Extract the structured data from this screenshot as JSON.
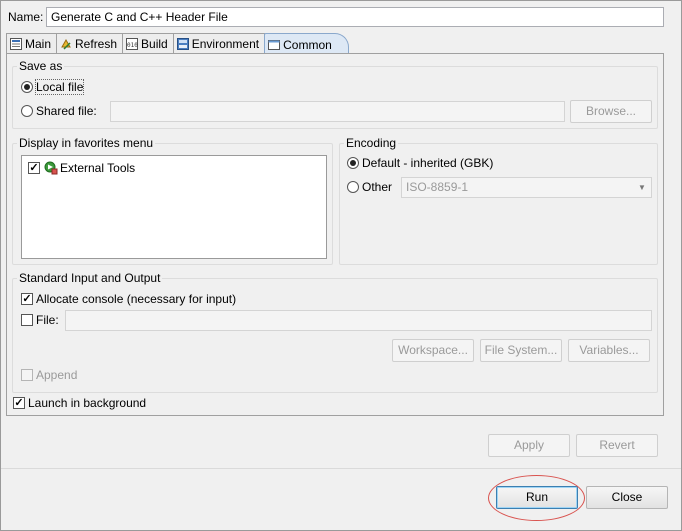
{
  "name_label": "Name:",
  "name_value": "Generate C and C++ Header File",
  "tabs": [
    {
      "label": "Main",
      "icon": "main-tab-icon"
    },
    {
      "label": "Refresh",
      "icon": "refresh-tab-icon"
    },
    {
      "label": "Build",
      "icon": "build-tab-icon"
    },
    {
      "label": "Environment",
      "icon": "environment-tab-icon"
    },
    {
      "label": "Common",
      "icon": "common-tab-icon",
      "active": true
    }
  ],
  "save_as": {
    "title": "Save as",
    "local_file": "Local file",
    "shared_file": "Shared file:",
    "browse": "Browse..."
  },
  "favorites": {
    "title": "Display in favorites menu",
    "items": [
      "External Tools"
    ]
  },
  "encoding": {
    "title": "Encoding",
    "default": "Default - inherited (GBK)",
    "other": "Other",
    "other_value": "ISO-8859-1"
  },
  "std_io": {
    "title": "Standard Input and Output",
    "allocate_console": "Allocate console (necessary for input)",
    "file": "File:",
    "workspace": "Workspace...",
    "file_system": "File System...",
    "variables": "Variables...",
    "append": "Append"
  },
  "launch_background": "Launch in background",
  "apply": "Apply",
  "revert": "Revert",
  "run": "Run",
  "close": "Close"
}
